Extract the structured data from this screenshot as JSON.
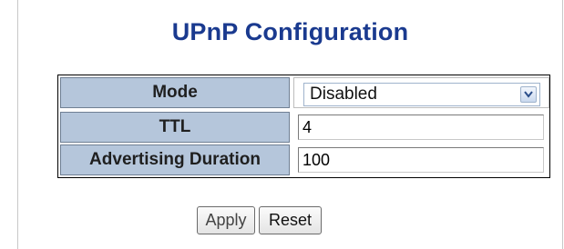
{
  "page": {
    "title": "UPnP Configuration"
  },
  "config": {
    "mode": {
      "label": "Mode",
      "value": "Disabled"
    },
    "ttl": {
      "label": "TTL",
      "value": "4"
    },
    "advertising_duration": {
      "label": "Advertising Duration",
      "value": "100"
    }
  },
  "actions": {
    "apply_label": "Apply",
    "reset_label": "Reset"
  },
  "icons": {
    "select_arrow": "chevron-down-icon"
  },
  "colors": {
    "title": "#1a3a8f",
    "label_cell_bg": "#b5c6db"
  }
}
